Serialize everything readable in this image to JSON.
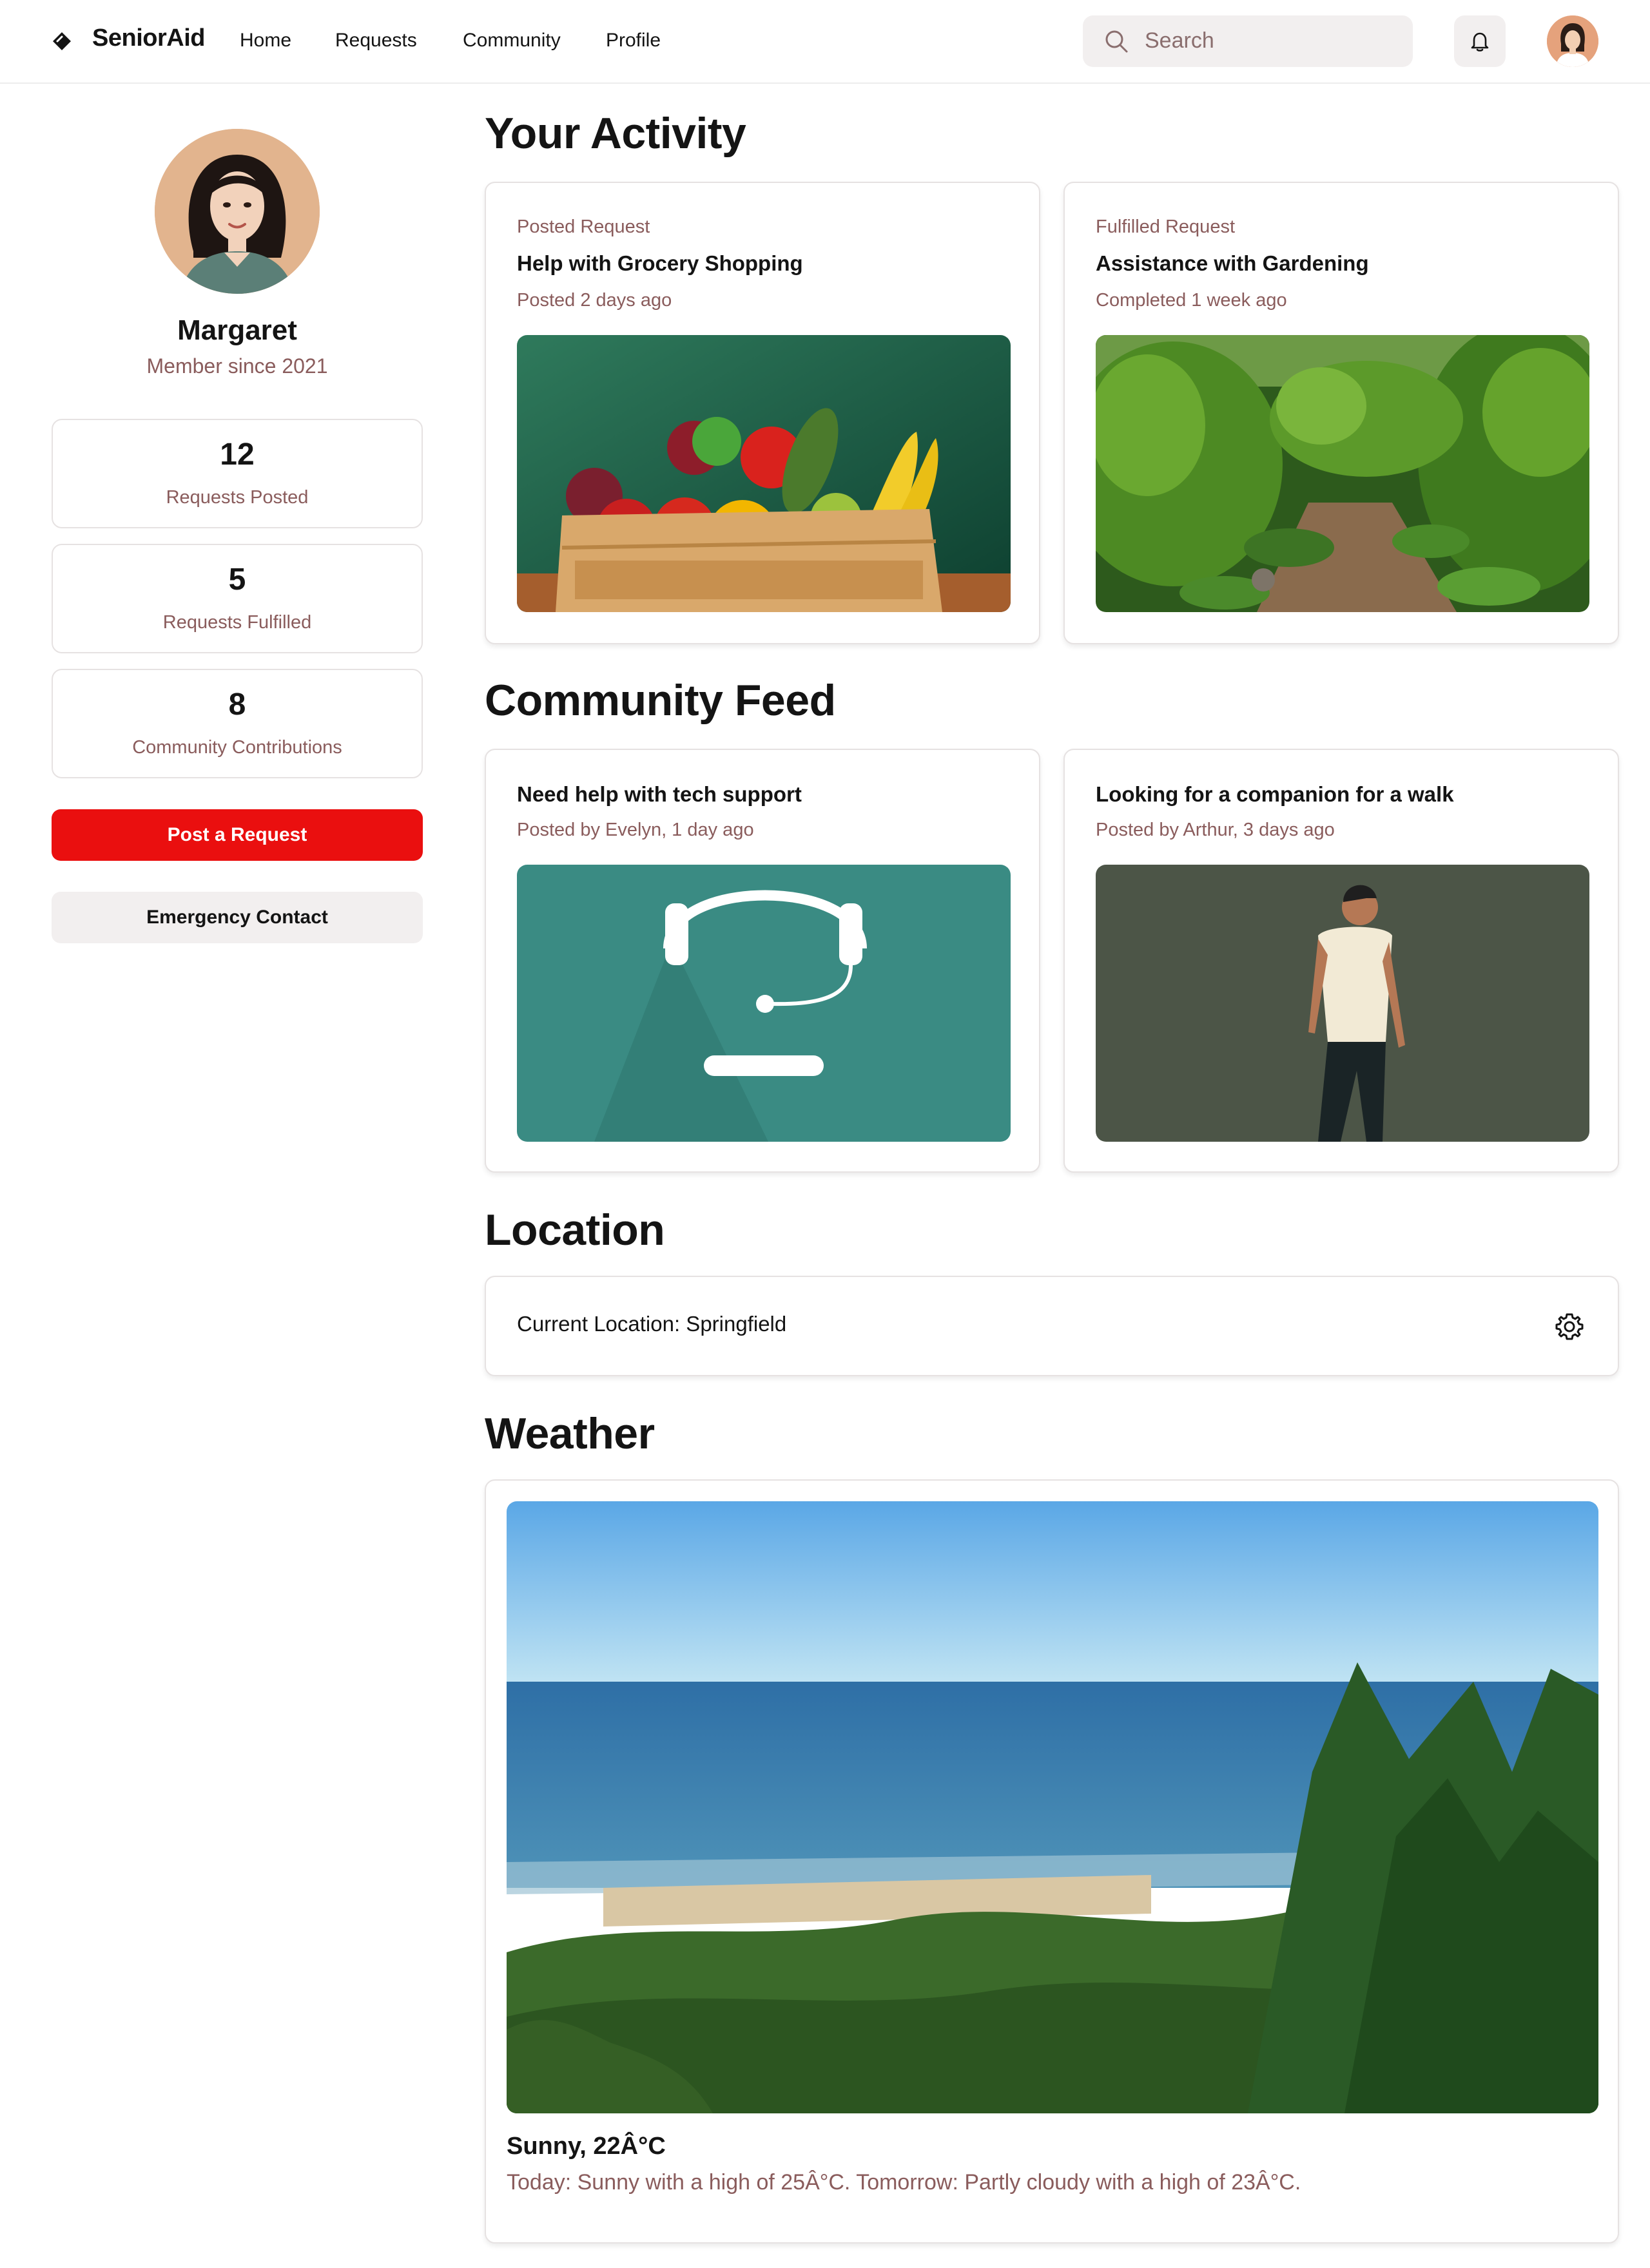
{
  "header": {
    "brand": "SeniorAid",
    "nav": [
      "Home",
      "Requests",
      "Community",
      "Profile"
    ],
    "search_placeholder": "Search",
    "icons": {
      "logo": "diamond-logo-icon",
      "search": "search-icon",
      "notifications": "bell-icon",
      "account": "user-avatar"
    }
  },
  "sidebar": {
    "name": "Margaret",
    "member_since": "Member since 2021",
    "stats": [
      {
        "value": "12",
        "label": "Requests Posted"
      },
      {
        "value": "5",
        "label": "Requests Fulfilled"
      },
      {
        "value": "8",
        "label": "Community Contributions"
      }
    ],
    "post_request_label": "Post a Request",
    "emergency_label": "Emergency Contact"
  },
  "activity": {
    "title": "Your Activity",
    "cards": [
      {
        "kicker": "Posted Request",
        "title": "Help with Grocery Shopping",
        "meta": "Posted 2 days ago"
      },
      {
        "kicker": "Fulfilled Request",
        "title": "Assistance with Gardening",
        "meta": "Completed 1 week ago"
      }
    ]
  },
  "feed": {
    "title": "Community Feed",
    "cards": [
      {
        "title": "Need help with tech support",
        "meta": "Posted by Evelyn, 1 day ago"
      },
      {
        "title": "Looking for a companion for a walk",
        "meta": "Posted by Arthur, 3 days ago"
      }
    ]
  },
  "location": {
    "title": "Location",
    "current": "Current Location: Springfield",
    "settings_icon": "gear-icon"
  },
  "weather": {
    "title": "Weather",
    "summary": "Sunny, 22Â°C",
    "forecast": "Today: Sunny with a high of 25Â°C. Tomorrow: Partly cloudy with a high of 23Â°C."
  },
  "colors": {
    "primary": "#ea0f0f",
    "muted_text": "#8a5c5c",
    "surface_grey": "#f2efef",
    "border": "#e6e2e2"
  }
}
